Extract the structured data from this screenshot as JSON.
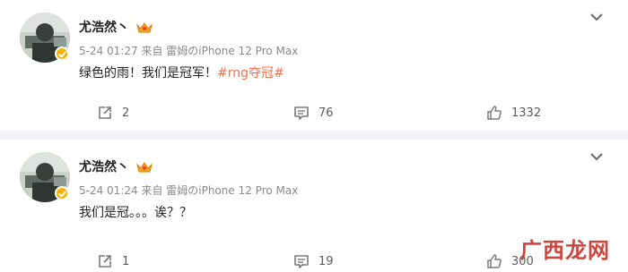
{
  "posts": [
    {
      "author": "尤浩然丶",
      "meta": "5-24 01:27  来自 雷姆のiPhone 12 Pro Max",
      "text": "绿色的雨！我们是冠军！",
      "hashtag": "#rng夺冠#",
      "reposts": "2",
      "comments": "76",
      "likes": "1332"
    },
    {
      "author": "尤浩然丶",
      "meta": "5-24 01:24  来自 雷姆のiPhone 12 Pro Max",
      "text": "我们是冠。。。诶？？",
      "reposts": "1",
      "comments": "19",
      "likes": "300"
    }
  ],
  "watermark": "广西龙网",
  "colors": {
    "hashtag": "#eb7350",
    "verify_badge": "#f7b300",
    "watermark": "#c8332a"
  },
  "icons": [
    "chevron-down-icon",
    "repost-icon",
    "comment-icon",
    "like-icon",
    "verified-badge-icon",
    "vip-crown-icon"
  ]
}
